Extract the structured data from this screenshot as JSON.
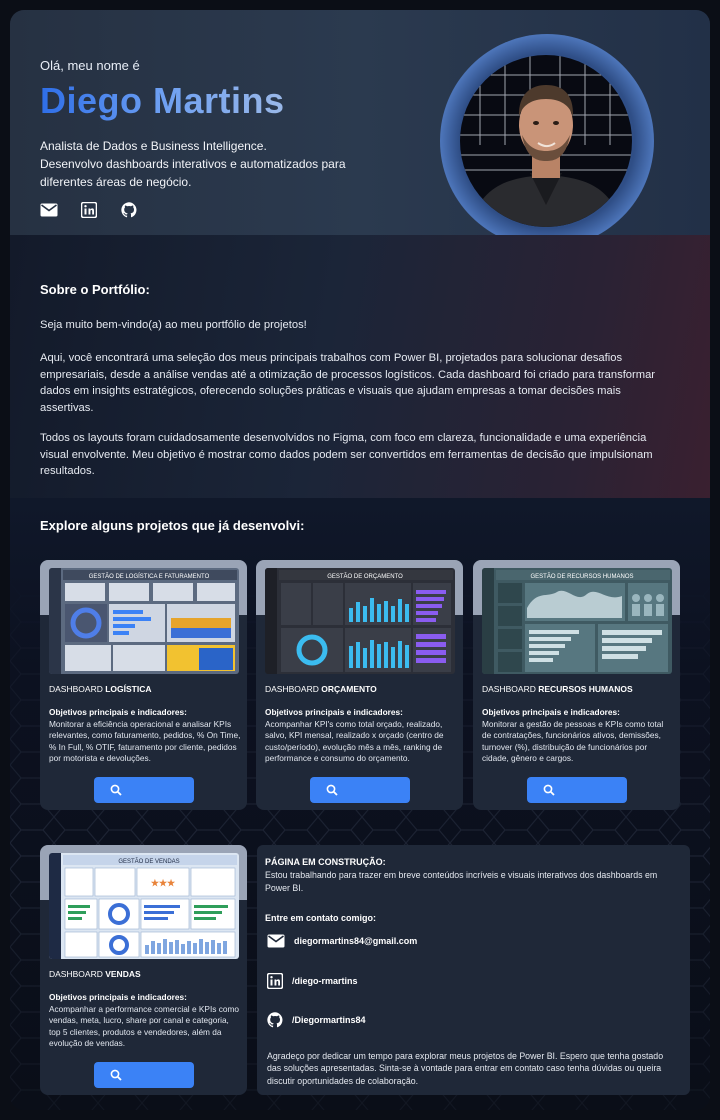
{
  "hero": {
    "greeting": "Olá, meu nome é",
    "name": "Diego Martins",
    "role_line1": "Analista de Dados e Business Intelligence.",
    "role_line2": "Desenvolvo dashboards interativos e automatizados para diferentes áreas de negócio.",
    "socials": [
      {
        "icon": "mail-icon"
      },
      {
        "icon": "linkedin-icon"
      },
      {
        "icon": "github-icon"
      }
    ]
  },
  "about": {
    "heading": "Sobre o Portfólio:",
    "p1": "Seja muito bem-vindo(a) ao meu portfólio de projetos!",
    "p2": "Aqui, você encontrará uma seleção dos meus principais trabalhos com Power BI, projetados para solucionar desafios empresariais, desde a análise vendas até a otimização de processos logísticos. Cada dashboard foi criado para transformar dados em insights estratégicos, oferecendo soluções práticas e visuais que ajudam empresas a tomar decisões mais assertivas.",
    "p3": "Todos os layouts foram cuidadosamente desenvolvidos no Figma, com foco em clareza, funcionalidade e uma experiência visual envolvente. Meu objetivo é mostrar como dados podem ser convertidos em ferramentas de decisão que impulsionam resultados."
  },
  "explore_heading": "Explore alguns projetos que já desenvolvi:",
  "projects": [
    {
      "prefix": "DASHBOARD ",
      "name": "LOGÍSTICA",
      "screenshot_title": "GESTÃO DE LOGÍSTICA E FATURAMENTO",
      "obj_label": "Objetivos principais e indicadores:",
      "obj_text": "Monitorar a eficiência operacional e analisar KPIs relevantes, como faturamento, pedidos, % On Time, % In Full, % OTIF, faturamento por cliente, pedidos por motorista e devoluções."
    },
    {
      "prefix": "DASHBOARD ",
      "name": "ORÇAMENTO",
      "screenshot_title": "GESTÃO DE ORÇAMENTO",
      "obj_label": "Objetivos principais e indicadores:",
      "obj_text": "Acompanhar KPI's como total orçado, realizado, salvo, KPI mensal, realizado x orçado (centro de custo/período), evolução mês a mês, ranking de performance e consumo do orçamento."
    },
    {
      "prefix": "DASHBOARD ",
      "name": "RECURSOS HUMANOS",
      "screenshot_title": "GESTÃO DE RECURSOS HUMANOS",
      "obj_label": "Objetivos principais e indicadores:",
      "obj_text": "Monitorar a gestão de pessoas e KPIs como total de contratações, funcionários ativos, demissões, turnover (%), distribuição de funcionários por cidade, gênero e cargos."
    },
    {
      "prefix": "DASHBOARD ",
      "name": "VENDAS",
      "screenshot_title": "GESTÃO DE VENDAS",
      "obj_label": "Objetivos principais e indicadores:",
      "obj_text": "Acompanhar a performance comercial e KPIs como vendas, meta, lucro, share por canal e categoria, top 5 clientes, produtos e vendedores, além da evolução de vendas."
    }
  ],
  "info": {
    "construction_title": "PÁGINA EM CONSTRUÇÃO:",
    "construction_text": "Estou trabalhando para trazer em breve conteúdos incríveis e visuais interativos dos dashboards em Power BI.",
    "contact_title": "Entre em contato comigo:",
    "email": "diegormartins84@gmail.com",
    "linkedin": "/diego-rmartins",
    "github": "/Diegormartins84",
    "thanks": "Agradeço por dedicar um tempo para explorar meus projetos de Power BI. Espero que tenha gostado das soluções apresentadas. Sinta-se à vontade para entrar em contato caso tenha dúvidas ou queira discutir oportunidades de colaboração."
  },
  "colors": {
    "accent": "#3b82f6",
    "card": "#1f2838",
    "name_gradient_start": "#2e6ee8"
  }
}
